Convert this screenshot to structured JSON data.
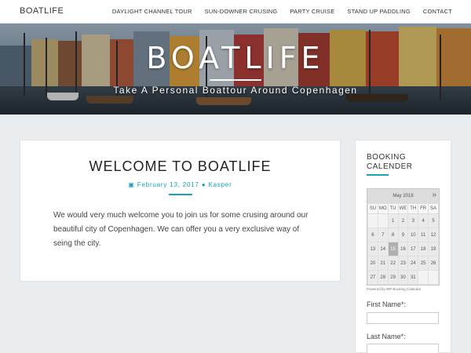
{
  "site": {
    "brand": "BOATLIFE"
  },
  "nav": {
    "items": [
      "DAYLIGHT CHANNEL TOUR",
      "SUN-DOWNER CRUSING",
      "PARTY CRUISE",
      "STAND UP PADDLING",
      "CONTACT"
    ]
  },
  "hero": {
    "title": "BOATLIFE",
    "subtitle": "Take A Personal Boattour Around Copenhagen"
  },
  "post": {
    "title": "WELCOME TO BOATLIFE",
    "date": "February 13, 2017",
    "author": "Kasper",
    "body": "We would very much welcome you to join us for some crusing around our beautiful city of Copenhagen. We can offer you a very exclusive way of seing the city."
  },
  "sidebar": {
    "title": "BOOKING CALENDER",
    "calendar": {
      "month": "May 2018",
      "next": "»",
      "weekdays": [
        "SU",
        "MO",
        "TU",
        "WE",
        "TH",
        "FR",
        "SA"
      ],
      "weeks": [
        [
          "",
          "",
          "1",
          "2",
          "3",
          "4",
          "5"
        ],
        [
          "6",
          "7",
          "8",
          "9",
          "10",
          "11",
          "12"
        ],
        [
          "13",
          "14",
          "15",
          "16",
          "17",
          "18",
          "19"
        ],
        [
          "20",
          "21",
          "22",
          "23",
          "24",
          "25",
          "26"
        ],
        [
          "27",
          "28",
          "29",
          "30",
          "31",
          "",
          ""
        ]
      ],
      "today": "15"
    },
    "powered": "Powered by WP Booking Calendar",
    "form": {
      "first_name_label": "First Name*:",
      "last_name_label": "Last Name*:"
    }
  },
  "colors": {
    "accent": "#17a2b8",
    "background": "#e9ecef"
  }
}
